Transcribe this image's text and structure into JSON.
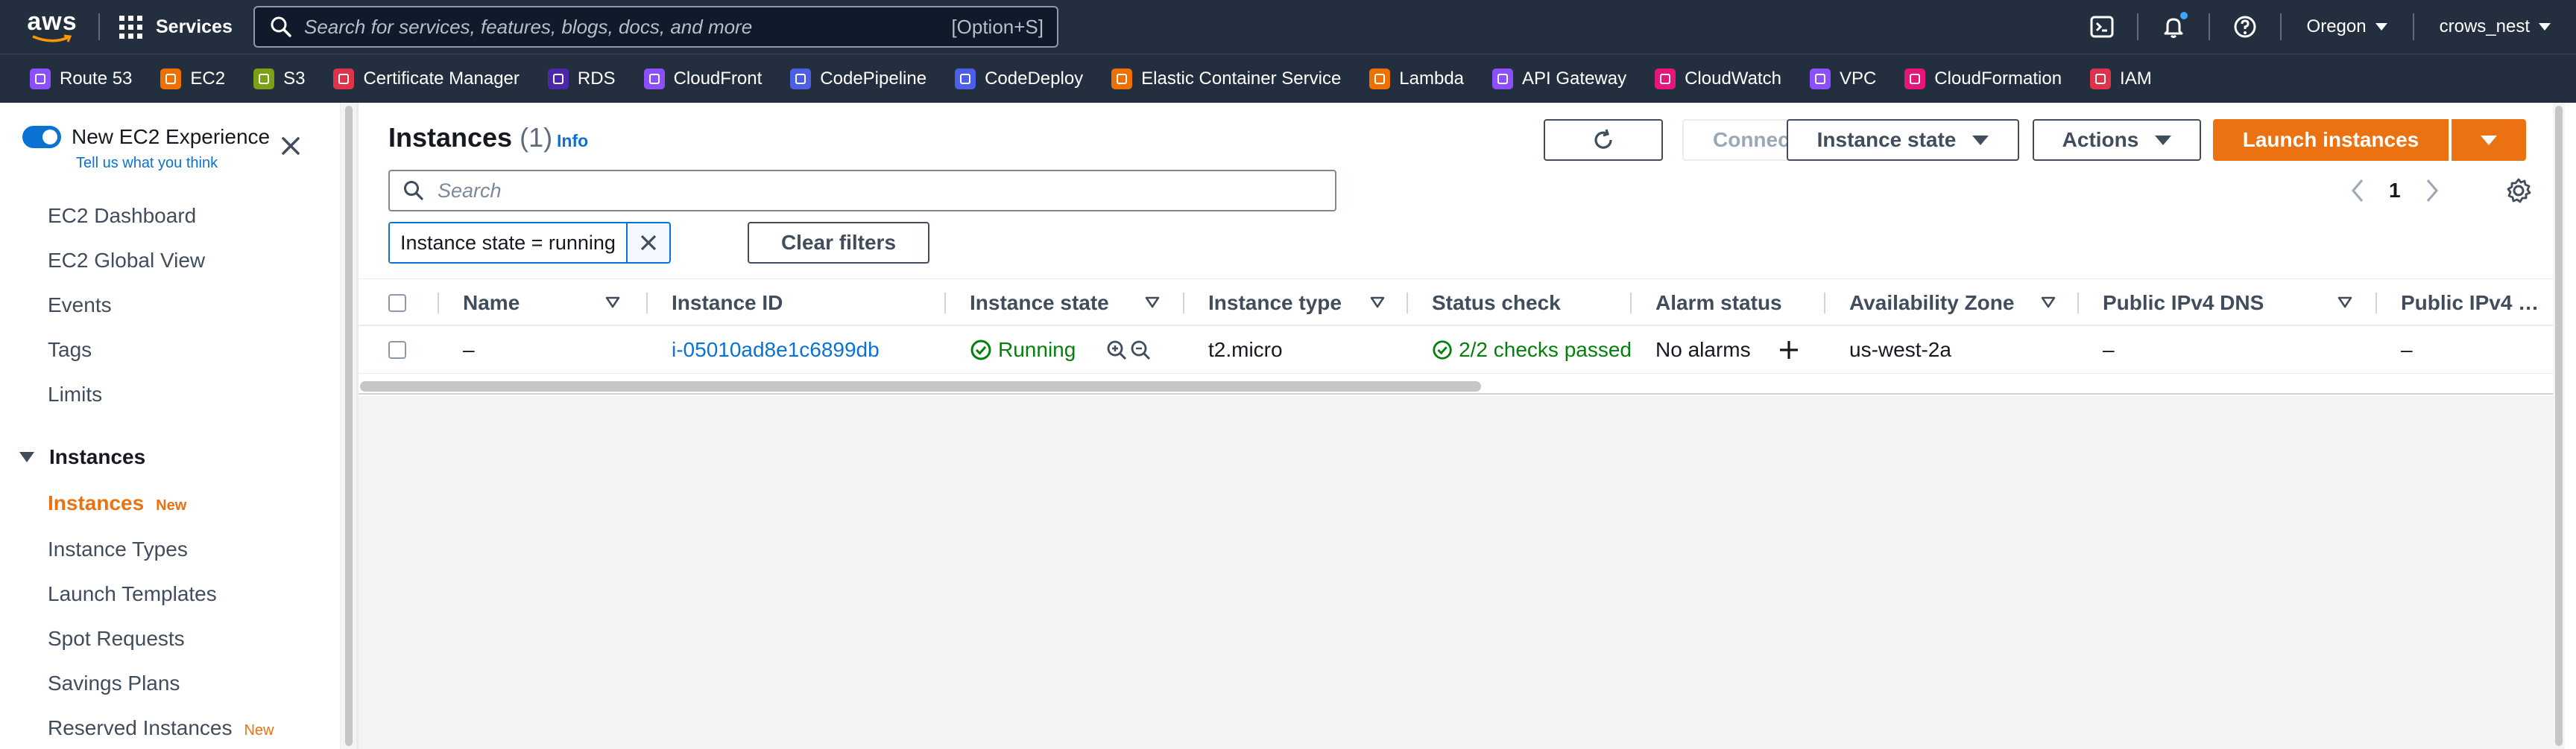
{
  "topnav": {
    "logo_text": "aws",
    "services_label": "Services",
    "search_placeholder": "Search for services, features, blogs, docs, and more",
    "search_shortcut": "[Option+S]",
    "region": "Oregon",
    "account": "crows_nest"
  },
  "favorites": [
    {
      "label": "Route 53",
      "color": "#8c4fff",
      "icon": "route53-icon"
    },
    {
      "label": "EC2",
      "color": "#ed7100",
      "icon": "ec2-icon"
    },
    {
      "label": "S3",
      "color": "#7aa116",
      "icon": "s3-icon"
    },
    {
      "label": "Certificate Manager",
      "color": "#dd344c",
      "icon": "certificate-manager-icon"
    },
    {
      "label": "RDS",
      "color": "#4d27aa",
      "icon": "rds-icon"
    },
    {
      "label": "CloudFront",
      "color": "#8c4fff",
      "icon": "cloudfront-icon"
    },
    {
      "label": "CodePipeline",
      "color": "#4d5fe6",
      "icon": "codepipeline-icon"
    },
    {
      "label": "CodeDeploy",
      "color": "#4d5fe6",
      "icon": "codedeploy-icon"
    },
    {
      "label": "Elastic Container Service",
      "color": "#ed7100",
      "icon": "ecs-icon"
    },
    {
      "label": "Lambda",
      "color": "#ed7100",
      "icon": "lambda-icon"
    },
    {
      "label": "API Gateway",
      "color": "#8c4fff",
      "icon": "api-gateway-icon"
    },
    {
      "label": "CloudWatch",
      "color": "#e7157b",
      "icon": "cloudwatch-icon"
    },
    {
      "label": "VPC",
      "color": "#8c4fff",
      "icon": "vpc-icon"
    },
    {
      "label": "CloudFormation",
      "color": "#e7157b",
      "icon": "cloudformation-icon"
    },
    {
      "label": "IAM",
      "color": "#dd344c",
      "icon": "iam-icon"
    }
  ],
  "sidenav": {
    "toggle_label": "New EC2 Experience",
    "tell_us": "Tell us what you think",
    "items": [
      "EC2 Dashboard",
      "EC2 Global View",
      "Events",
      "Tags",
      "Limits"
    ],
    "section": "Instances",
    "section_items": [
      {
        "label": "Instances",
        "badge": "New"
      },
      {
        "label": "Instance Types",
        "badge": ""
      },
      {
        "label": "Launch Templates",
        "badge": ""
      },
      {
        "label": "Spot Requests",
        "badge": ""
      },
      {
        "label": "Savings Plans",
        "badge": ""
      },
      {
        "label": "Reserved Instances",
        "badge": "New"
      }
    ]
  },
  "main": {
    "title": "Instances",
    "count": "(1)",
    "info": "Info",
    "buttons": {
      "connect": "Connect",
      "instance_state": "Instance state",
      "actions": "Actions",
      "launch": "Launch instances",
      "clear_filters": "Clear filters"
    },
    "search_placeholder": "Search",
    "filter_token": "Instance state = running",
    "page": "1"
  },
  "table": {
    "columns": [
      "Name",
      "Instance ID",
      "Instance state",
      "Instance type",
      "Status check",
      "Alarm status",
      "Availability Zone",
      "Public IPv4 DNS",
      "Public IPv4 …"
    ],
    "rows": [
      {
        "name": "–",
        "instance_id": "i-05010ad8e1c6899db",
        "state": "Running",
        "type": "t2.micro",
        "status_check": "2/2 checks passed",
        "alarm": "No alarms",
        "az": "us-west-2a",
        "dns": "–",
        "ip": "–"
      }
    ]
  },
  "colors": {
    "nav_bg": "#232f3e",
    "primary": "#ec7211",
    "link": "#0972d3",
    "success": "#037f0c"
  }
}
